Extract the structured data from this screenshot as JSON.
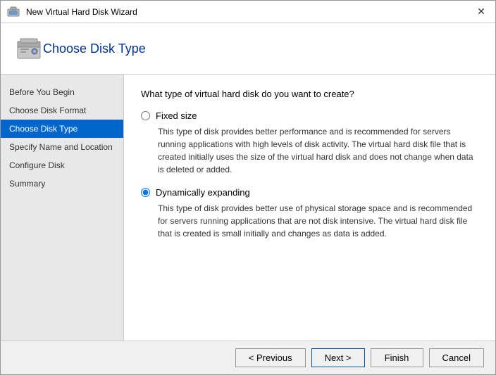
{
  "window": {
    "title": "New Virtual Hard Disk Wizard",
    "close_label": "✕"
  },
  "header": {
    "title": "Choose Disk Type"
  },
  "sidebar": {
    "items": [
      {
        "id": "before-you-begin",
        "label": "Before You Begin",
        "active": false
      },
      {
        "id": "choose-disk-format",
        "label": "Choose Disk Format",
        "active": false
      },
      {
        "id": "choose-disk-type",
        "label": "Choose Disk Type",
        "active": true
      },
      {
        "id": "specify-name-location",
        "label": "Specify Name and Location",
        "active": false
      },
      {
        "id": "configure-disk",
        "label": "Configure Disk",
        "active": false
      },
      {
        "id": "summary",
        "label": "Summary",
        "active": false
      }
    ]
  },
  "main": {
    "question": "What type of virtual hard disk do you want to create?",
    "options": [
      {
        "id": "fixed-size",
        "label": "Fixed size",
        "checked": false,
        "description": "This type of disk provides better performance and is recommended for servers running applications with high levels of disk activity. The virtual hard disk file that is created initially uses the size of the virtual hard disk and does not change when data is deleted or added."
      },
      {
        "id": "dynamically-expanding",
        "label": "Dynamically expanding",
        "checked": true,
        "description": "This type of disk provides better use of physical storage space and is recommended for servers running applications that are not disk intensive. The virtual hard disk file that is created is small initially and changes as data is added."
      }
    ]
  },
  "footer": {
    "previous_label": "< Previous",
    "next_label": "Next >",
    "finish_label": "Finish",
    "cancel_label": "Cancel"
  }
}
